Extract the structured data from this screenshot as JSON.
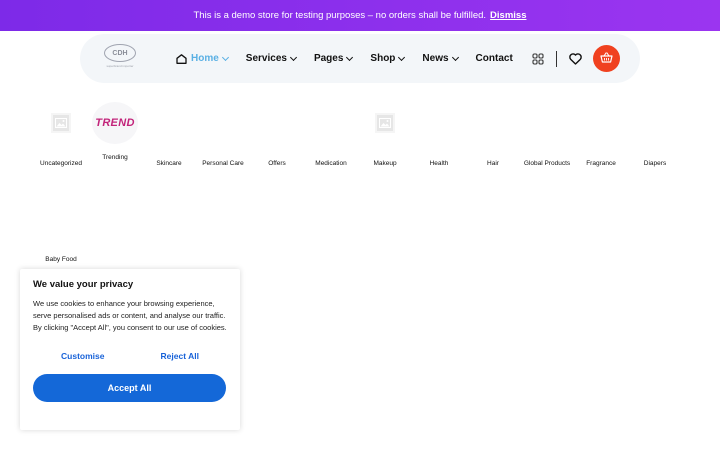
{
  "demo_bar": {
    "message": "This is a demo store for testing purposes – no orders shall be fulfilled.",
    "dismiss": "Dismiss"
  },
  "header": {
    "logo_text": "CDH",
    "logo_tagline": "superbrand importer",
    "nav": [
      {
        "label": "Home",
        "has_dropdown": true,
        "active": true
      },
      {
        "label": "Services",
        "has_dropdown": true
      },
      {
        "label": "Pages",
        "has_dropdown": true
      },
      {
        "label": "Shop",
        "has_dropdown": true
      },
      {
        "label": "News",
        "has_dropdown": true
      },
      {
        "label": "Contact",
        "has_dropdown": false
      }
    ],
    "icons": [
      "compare-icon",
      "wishlist-heart-icon",
      "cart-basket-icon"
    ],
    "accent_color": "#f0411f"
  },
  "categories": [
    {
      "label": "Uncategorized",
      "thumb": "placeholder-image-icon"
    },
    {
      "label": "Trending",
      "thumb": "trend-logo"
    },
    {
      "label": "Skincare"
    },
    {
      "label": "Personal Care"
    },
    {
      "label": "Offers"
    },
    {
      "label": "Medication"
    },
    {
      "label": "Makeup",
      "thumb": "placeholder-image-icon"
    },
    {
      "label": "Health"
    },
    {
      "label": "Hair"
    },
    {
      "label": "Global Products"
    },
    {
      "label": "Fragrance"
    },
    {
      "label": "Diapers"
    },
    {
      "label": "Baby Food"
    }
  ],
  "trend_logo_text": "TREND",
  "cookie_banner": {
    "title": "We value your privacy",
    "body": "We use cookies to enhance your browsing experience, serve personalised ads or content, and analyse our traffic. By clicking \"Accept All\", you consent to our use of cookies.",
    "customise": "Customise",
    "reject": "Reject All",
    "accept": "Accept All",
    "accent_color": "#1468d8"
  }
}
